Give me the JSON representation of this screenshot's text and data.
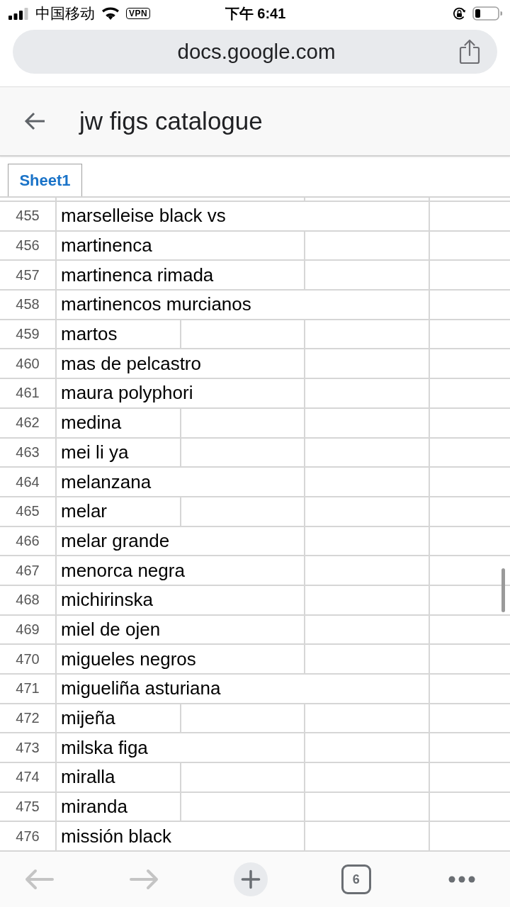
{
  "status_bar": {
    "carrier": "中国移动",
    "vpn": "VPN",
    "time": "下午 6:41"
  },
  "address_bar": {
    "url": "docs.google.com"
  },
  "header": {
    "title": "jw figs catalogue"
  },
  "sheet_tabs": [
    {
      "label": "Sheet1",
      "selected": true
    }
  ],
  "grid": {
    "rows": [
      {
        "number": "455",
        "text": "marselleise black vs"
      },
      {
        "number": "456",
        "text": "martinenca"
      },
      {
        "number": "457",
        "text": "martinenca rimada"
      },
      {
        "number": "458",
        "text": "martinencos murcianos"
      },
      {
        "number": "459",
        "text": "martos"
      },
      {
        "number": "460",
        "text": "mas de pelcastro"
      },
      {
        "number": "461",
        "text": "maura polyphori"
      },
      {
        "number": "462",
        "text": "medina"
      },
      {
        "number": "463",
        "text": "mei li ya"
      },
      {
        "number": "464",
        "text": "melanzana"
      },
      {
        "number": "465",
        "text": "melar"
      },
      {
        "number": "466",
        "text": "melar grande"
      },
      {
        "number": "467",
        "text": "menorca negra"
      },
      {
        "number": "468",
        "text": "michirinska"
      },
      {
        "number": "469",
        "text": "miel de ojen"
      },
      {
        "number": "470",
        "text": "migueles negros"
      },
      {
        "number": "471",
        "text": "migueliña asturiana"
      },
      {
        "number": "472",
        "text": "mijeña"
      },
      {
        "number": "473",
        "text": "milska figa"
      },
      {
        "number": "474",
        "text": "miralla"
      },
      {
        "number": "475",
        "text": "miranda"
      },
      {
        "number": "476",
        "text": "missión black"
      }
    ]
  },
  "toolbar": {
    "items": [
      {
        "kind": "back",
        "disabled": true
      },
      {
        "kind": "forward",
        "disabled": true
      },
      {
        "kind": "new-tab",
        "disabled": false
      },
      {
        "kind": "tabs",
        "label": "6",
        "disabled": false
      },
      {
        "kind": "more",
        "disabled": false
      }
    ]
  }
}
